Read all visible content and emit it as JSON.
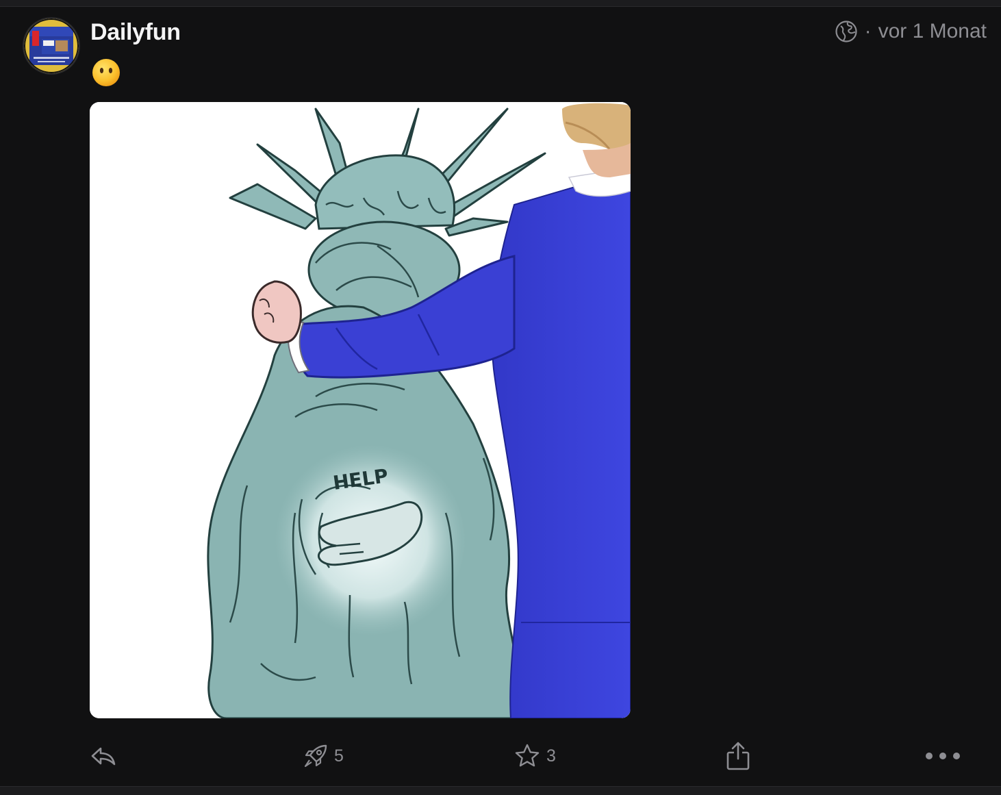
{
  "post": {
    "author": "Dailyfun",
    "status_emoji": "face-without-mouth",
    "visibility_icon": "globe-icon",
    "timestamp": "vor 1 Monat",
    "image": {
      "caption_text": "HELP"
    }
  },
  "actions": {
    "reply": {
      "icon": "reply-icon"
    },
    "boost": {
      "icon": "rocket-icon",
      "count": "5"
    },
    "favourite": {
      "icon": "star-icon",
      "count": "3"
    },
    "share": {
      "icon": "share-icon"
    },
    "more": {
      "icon": "more-icon"
    }
  },
  "colors": {
    "background": "#111112",
    "text": "#f4f4f5",
    "muted": "#8e8e93",
    "suit_blue": "#3a3fd6",
    "statue_green": "#8cb7b5"
  }
}
